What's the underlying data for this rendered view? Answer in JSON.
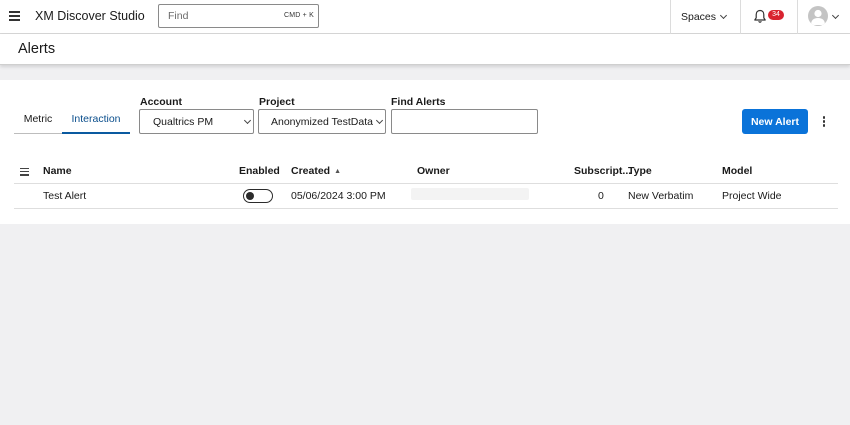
{
  "topbar": {
    "app_title": "XM Discover Studio",
    "search_placeholder": "Find",
    "search_shortcut": "CMD + K",
    "spaces_label": "Spaces",
    "notification_count": "34"
  },
  "page": {
    "title": "Alerts"
  },
  "tabs": [
    {
      "label": "Metric",
      "active": false
    },
    {
      "label": "Interaction",
      "active": true
    }
  ],
  "filters": {
    "account_label": "Account",
    "account_value": "Qualtrics PM",
    "project_label": "Project",
    "project_value": "Anonymized TestData",
    "find_label": "Find Alerts",
    "find_value": ""
  },
  "actions": {
    "new_alert_label": "New Alert"
  },
  "table": {
    "columns": [
      "Name",
      "Enabled",
      "Created",
      "Owner",
      "Subscript...",
      "Type",
      "Model"
    ],
    "sort_indicator": "▲",
    "rows": [
      {
        "name": "Test Alert",
        "enabled": false,
        "created": "05/06/2024 3:00 PM",
        "owner": "",
        "subscriptions": "0",
        "type": "New Verbatim",
        "model": "Project Wide"
      }
    ]
  },
  "colors": {
    "accent": "#0a73d9",
    "active_tab": "#0a4e8c",
    "badge": "#d92330",
    "background": "#f0f0f2"
  },
  "icons": [
    "hamburger-menu-icon",
    "bell-icon",
    "avatar-icon",
    "chevron-down-icon",
    "kebab-menu-icon",
    "column-menu-icon"
  ]
}
